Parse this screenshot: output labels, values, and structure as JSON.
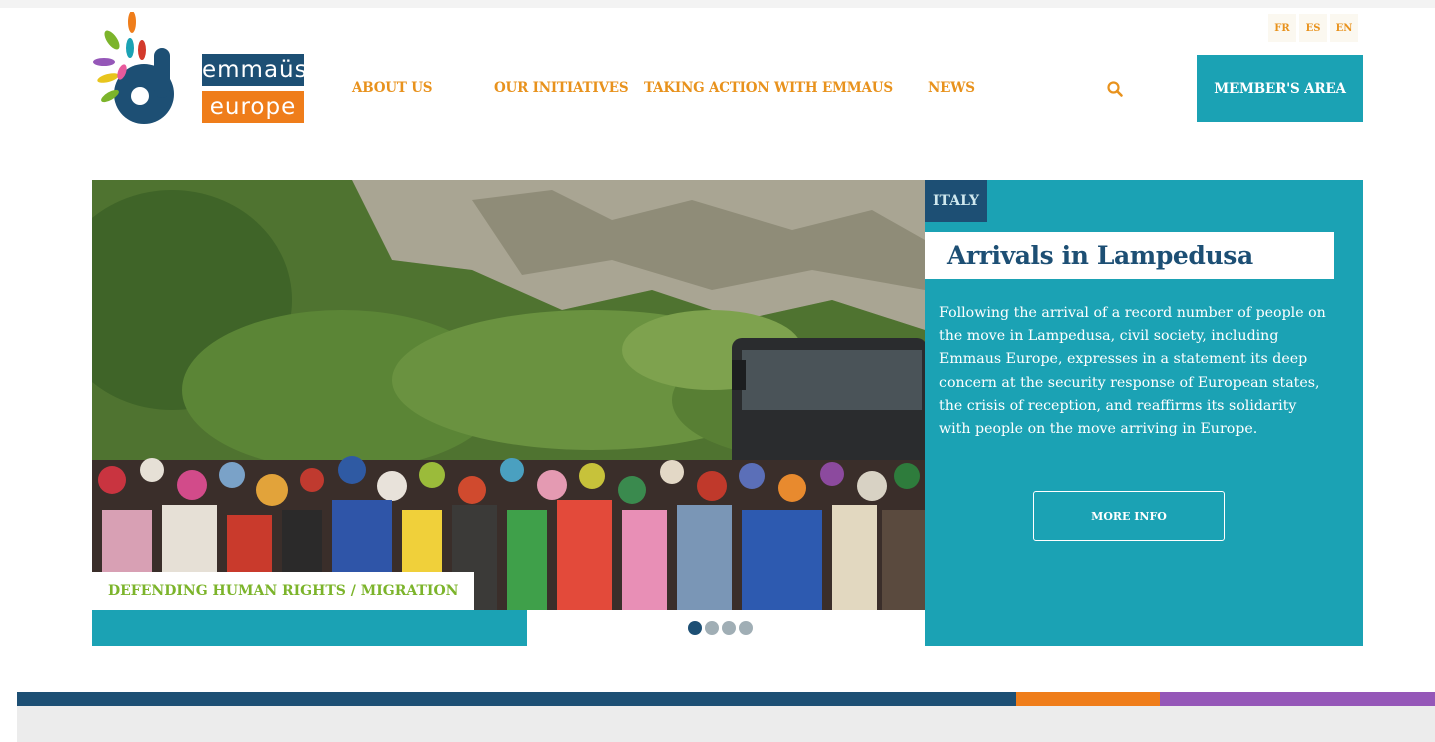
{
  "logo": {
    "line1": "emmaüs",
    "line2": "europe"
  },
  "languages": [
    "FR",
    "ES",
    "EN"
  ],
  "nav": {
    "about": "ABOUT US",
    "initiatives": "OUR INITIATIVES",
    "taking_action": "TAKING ACTION WITH EMMAUS",
    "news": "NEWS",
    "member": "MEMBER'S AREA"
  },
  "slide": {
    "category": "DEFENDING HUMAN RIGHTS / MIGRATION",
    "country": "ITALY",
    "title": "Arrivals in Lampedusa",
    "description": "Following the arrival of a record number of people on the move in Lampedusa, civil society, including Emmaus Europe, expresses in a statement its deep concern at the security response of European states, the crisis of reception, and reaffirms its solidarity with people on the move arriving in Europe.",
    "button": "MORE INFO"
  },
  "slider": {
    "total_slides": 4,
    "active_slide": 1
  },
  "colors": {
    "teal": "#1ba2b4",
    "navy": "#1d4f74",
    "orange": "#ef7d1a",
    "nav_text": "#e8921d",
    "green": "#7cb42b",
    "purple": "#9557b8"
  }
}
